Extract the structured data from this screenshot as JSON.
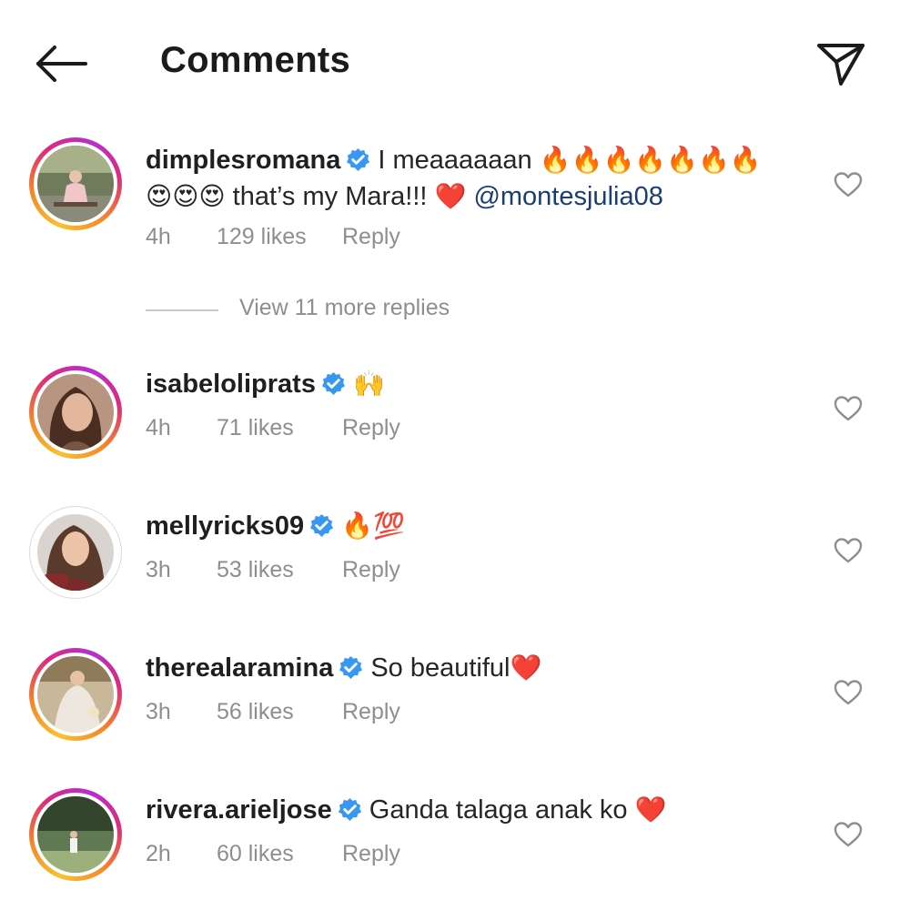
{
  "header": {
    "title": "Comments",
    "back_icon": "arrow-left-icon",
    "share_icon": "paper-plane-icon"
  },
  "comments": [
    {
      "username": "dimplesromana",
      "verified": true,
      "text_part1": "I meaaaaaan",
      "emoji1": "🔥🔥🔥🔥🔥🔥🔥",
      "emoji2": "😍😍😍",
      "text_part2": "that’s my Mara!!!",
      "emoji3": "❤️",
      "mention": "@montesjulia08",
      "time": "4h",
      "likes": "129 likes",
      "reply": "Reply"
    },
    {
      "username": "isabeloliprats",
      "verified": true,
      "emoji1": "🙌",
      "time": "4h",
      "likes": "71 likes",
      "reply": "Reply"
    },
    {
      "username": "mellyricks09",
      "verified": true,
      "emoji1": "🔥💯",
      "time": "3h",
      "likes": "53 likes",
      "reply": "Reply"
    },
    {
      "username": "therealaramina",
      "verified": true,
      "text_part1": "So beautiful",
      "emoji1": "❤️",
      "time": "3h",
      "likes": "56 likes",
      "reply": "Reply"
    },
    {
      "username": "rivera.arieljose",
      "verified": true,
      "text_part1": "Ganda talaga anak ko",
      "emoji1": "❤️",
      "time": "2h",
      "likes": "60 likes",
      "reply": "Reply"
    }
  ],
  "view_replies": "View 11 more replies",
  "colors": {
    "verified_blue": "#3897f0",
    "mention_blue": "#1a3d72",
    "meta_gray": "#8e8e8e"
  }
}
